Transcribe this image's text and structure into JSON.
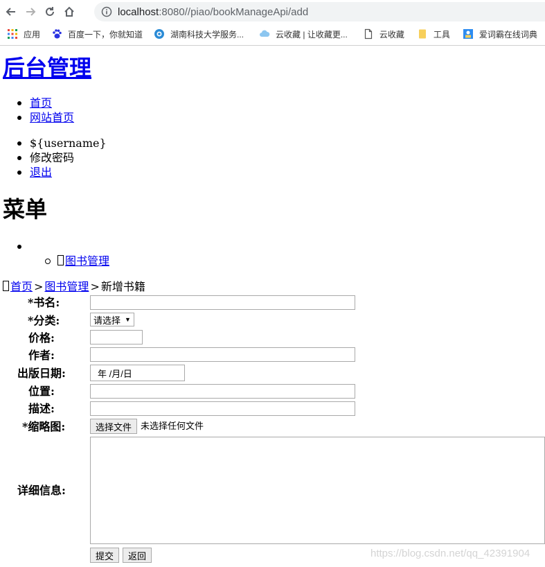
{
  "browser": {
    "url_host": "localhost",
    "url_path": ":8080//piao/bookManageApi/add"
  },
  "bookmarks": [
    {
      "label": "应用",
      "icon": "apps-grid-icon"
    },
    {
      "label": "百度一下，你就知道",
      "icon": "baidu-paw-icon"
    },
    {
      "label": "湖南科技大学服务...",
      "icon": "university-icon"
    },
    {
      "label": "云收藏 | 让收藏更...",
      "icon": "cloud-icon"
    },
    {
      "label": "云收藏",
      "icon": "document-icon"
    },
    {
      "label": "工具",
      "icon": "folder-icon"
    },
    {
      "label": "爱词霸在线词典",
      "icon": "dictionary-icon"
    }
  ],
  "page": {
    "site_title": "后台管理",
    "nav": [
      "首页",
      "网站首页"
    ],
    "user": [
      "${username}",
      "修改密码",
      "退出"
    ],
    "menu_title": "菜单",
    "menu_sub_item": "图书管理",
    "breadcrumb": {
      "home": "首页",
      "section": "图书管理",
      "current": "新增书籍",
      "sep": ">"
    }
  },
  "form": {
    "labels": {
      "book_name": "*书名:",
      "category": "*分类:",
      "price": "价格:",
      "author": "作者:",
      "pub_date": "出版日期:",
      "location": "位置:",
      "description": "描述:",
      "thumbnail": "*缩略图:",
      "details": "详细信息:"
    },
    "category_selected": "请选择",
    "date_placeholder": "年 /月/日",
    "file_button": "选择文件",
    "file_status": "未选择任何文件",
    "submit": "提交",
    "back": "返回"
  },
  "watermark": "https://blog.csdn.net/qq_42391904"
}
